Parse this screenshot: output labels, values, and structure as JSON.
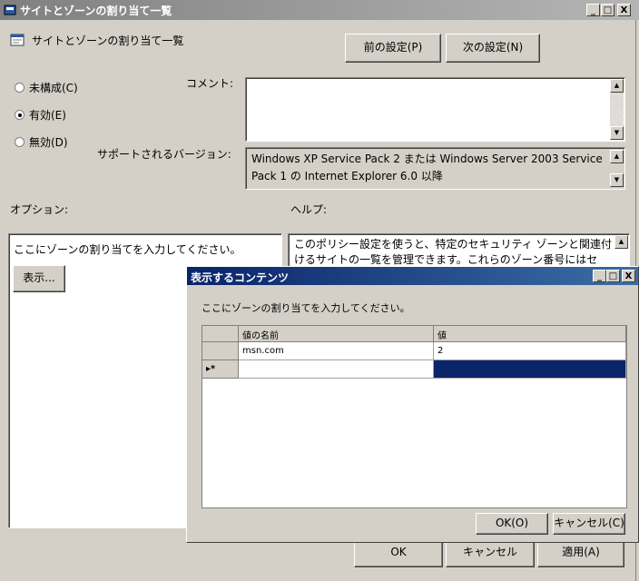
{
  "window": {
    "title": "サイトとゾーンの割り当て一覧",
    "controls": [
      "_",
      "□",
      "X"
    ]
  },
  "header": {
    "setting_name": "サイトとゾーンの割り当て一覧",
    "prev_button": "前の設定(P)",
    "next_button": "次の設定(N)"
  },
  "state": {
    "options": [
      {
        "label": "未構成(C)",
        "selected": false
      },
      {
        "label": "有効(E)",
        "selected": true
      },
      {
        "label": "無効(D)",
        "selected": false
      }
    ]
  },
  "comment": {
    "label": "コメント:",
    "value": ""
  },
  "supported": {
    "label": "サポートされるバージョン:",
    "value": "Windows XP Service Pack 2 または Windows Server 2003 Service Pack 1 の Internet Explorer 6.0 以降"
  },
  "options_section": {
    "label": "オプション:",
    "prompt": "ここにゾーンの割り当てを入力してください。",
    "show_button": "表示..."
  },
  "help_section": {
    "label": "ヘルプ:",
    "text": "このポリシー設定を使うと、特定のセキュリティ ゾーンと関連付けるサイトの一覧を管理できます。これらのゾーン番号にはセ"
  },
  "footer": {
    "ok": "OK",
    "cancel": "キャンセル",
    "apply": "適用(A)"
  },
  "dialog": {
    "title": "表示するコンテンツ",
    "controls": [
      "_",
      "□",
      "X"
    ],
    "prompt": "ここにゾーンの割り当てを入力してください。",
    "columns": [
      "値の名前",
      "値"
    ],
    "rows": [
      {
        "marker": "",
        "name": "msn.com",
        "value": "2"
      },
      {
        "marker": "▸*",
        "name": "",
        "value": ""
      }
    ],
    "ok": "OK(O)",
    "cancel": "キャンセル(C)"
  },
  "colors": {
    "face": "#d4d0c8",
    "active_title": "#0a246a",
    "inactive_title": "#808080",
    "selection": "#0a246a"
  }
}
